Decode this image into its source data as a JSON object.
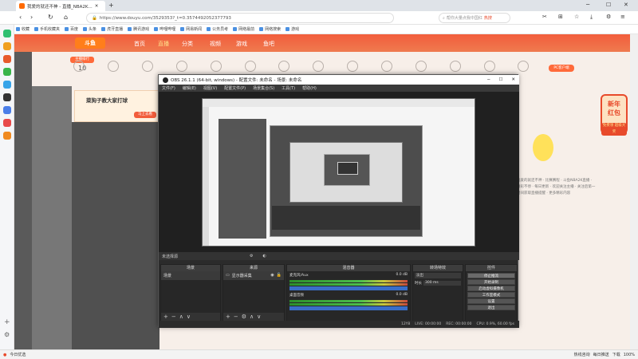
{
  "browser": {
    "tab_title": "我爱的就还不神 - 直播_NBA2K...",
    "url": "https://www.douyu.com/3529353?_t=0.3574492052377793",
    "search_placeholder": "帮你大量点我中国红",
    "search_tag": "热搜",
    "bookmarks": [
      "收藏",
      "手机收藏夹",
      "百度",
      "头条",
      "虎牙直播",
      "腾讯游戏",
      "哔哩哔哩",
      "网易新闻",
      "公务员考",
      "网络最前",
      "网络搜索",
      "游戏"
    ],
    "status_left": "今日优选",
    "status_right": [
      "热线咨询",
      "每日推送",
      "下载",
      "100%"
    ]
  },
  "douyu": {
    "logo": "斗鱼",
    "nav": [
      "首页",
      "直播",
      "分类",
      "视频",
      "游戏",
      "鱼吧"
    ],
    "rank_label": "主播排行",
    "rank_number": "10",
    "banner_text": "菜狗子教大家打球",
    "hot_button": "马上去看",
    "pc_badge": "PC客户端",
    "xinnian_line1": "新年",
    "xinnian_line2": "红包",
    "hongbao_text": "免费领 超级大奖",
    "article_text": "我爱的就还不神 · 比赛赛程 · 斗鱼NBA2K直播 · 精彩不停 · 每日更新 · 欢迎关注主播 · 关注后第一时间获取直播提醒 · 更多精彩内容"
  },
  "obs": {
    "title": "OBS 26.1.1 (64-bit, windows) - 配置文件: 未命名 - 场景: 未命名",
    "menu": [
      "文件(F)",
      "编辑(E)",
      "视图(V)",
      "配置文件(P)",
      "场景集合(S)",
      "工具(T)",
      "帮助(H)"
    ],
    "strip_label": "未选择源",
    "docks": {
      "scenes": {
        "title": "场景",
        "items": [
          "场景"
        ]
      },
      "sources": {
        "title": "来源",
        "items": [
          "显示器采集"
        ]
      },
      "mixer": {
        "title": "混音器",
        "channels": [
          {
            "name": "麦克风/Aux",
            "db": "0.0 dB"
          },
          {
            "name": "桌面音频",
            "db": "0.0 dB"
          }
        ]
      },
      "transitions": {
        "title": "转场特效",
        "type": "淡出",
        "duration_label": "时长",
        "duration": "300 ms"
      },
      "controls": {
        "title": "控件",
        "buttons": [
          "停止推流",
          "开始录制",
          "启动虚拟摄像机",
          "工作室模式",
          "设置",
          "退出"
        ]
      }
    },
    "status": {
      "dropped": "12Y8",
      "live": "LIVE: 00:00:00",
      "rec": "REC: 00:00:00",
      "cpu": "CPU: 0.9%, 60.00 fps"
    }
  }
}
